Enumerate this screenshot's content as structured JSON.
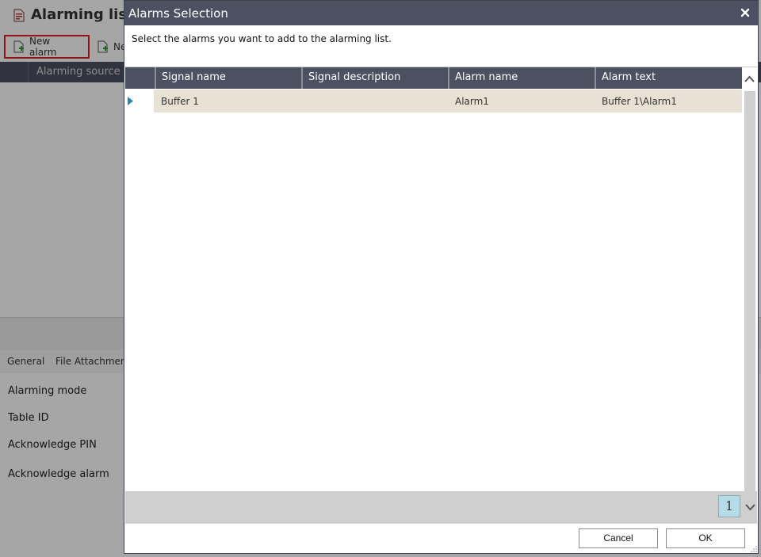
{
  "background": {
    "app_title": "Alarming list",
    "toolbar": {
      "new_alarm_label": "New alarm",
      "second_button_label": "Ne"
    },
    "grid": {
      "column_header": "Alarming source"
    },
    "tabs": [
      "General",
      "File Attachment"
    ],
    "properties": [
      "Alarming mode",
      "Table ID",
      "Acknowledge PIN",
      "Acknowledge alarm"
    ]
  },
  "dialog": {
    "title": "Alarms Selection",
    "instruction": "Select the alarms you want to add to the alarming list.",
    "columns": [
      "Signal name",
      "Signal description",
      "Alarm name",
      "Alarm text"
    ],
    "rows": [
      {
        "signal_name": "Buffer 1",
        "signal_description": "",
        "alarm_name": "Alarm1",
        "alarm_text": "Buffer 1\\Alarm1",
        "selected": true
      }
    ],
    "pager": {
      "current_page": "1"
    },
    "buttons": {
      "cancel": "Cancel",
      "ok": "OK"
    }
  },
  "colors": {
    "dialog_header": "#4c5161",
    "selected_row": "#e9e1d4",
    "page_button": "#b5dbe6",
    "row_arrow": "#2a86b5",
    "highlight_border": "#e02020"
  },
  "icons": {
    "app_title_icon": "document-icon",
    "new_alarm_icon": "file-plus-icon",
    "close_icon": "close-icon",
    "scroll_up_icon": "chevron-up-icon",
    "scroll_down_icon": "chevron-down-icon",
    "row_indicator_icon": "triangle-right-icon"
  }
}
